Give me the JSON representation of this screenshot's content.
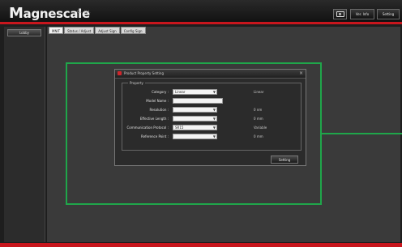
{
  "app": {
    "logo_text": "agnescale",
    "logo_initial": "M",
    "logo_sub": "Co., Ltd."
  },
  "toolbar": {
    "camera_icon": "camera-icon",
    "version_info_label": "Ver. Info",
    "setting_label": "Setting"
  },
  "sidebar": {
    "items": [
      {
        "label": "Lobby"
      }
    ]
  },
  "tabs": [
    {
      "label": "MNIT"
    },
    {
      "label": "Status / Adjust"
    },
    {
      "label": "Adjust Sign"
    },
    {
      "label": "Config Sign"
    }
  ],
  "dialog": {
    "title": "Product Property Setting",
    "close_glyph": "×",
    "group_label": "Property",
    "fields": [
      {
        "label": "Category :",
        "value": "Linear",
        "type": "select",
        "unit": "Linear"
      },
      {
        "label": "Model Name :",
        "value": "",
        "type": "text",
        "unit": ""
      },
      {
        "label": "Resolution :",
        "value": "",
        "type": "select",
        "unit": "0  nm"
      },
      {
        "label": "Effective Length :",
        "value": "",
        "type": "select",
        "unit": "0  mm"
      },
      {
        "label": "Communication Protocol :",
        "value": "SR15",
        "type": "select",
        "unit": "Variable"
      },
      {
        "label": "Reference Point :",
        "value": "",
        "type": "select",
        "unit": "0  mm"
      }
    ],
    "setting_button": "Setting"
  },
  "colors": {
    "accent_red": "#c8161d",
    "highlight_green": "#1fa64a"
  }
}
